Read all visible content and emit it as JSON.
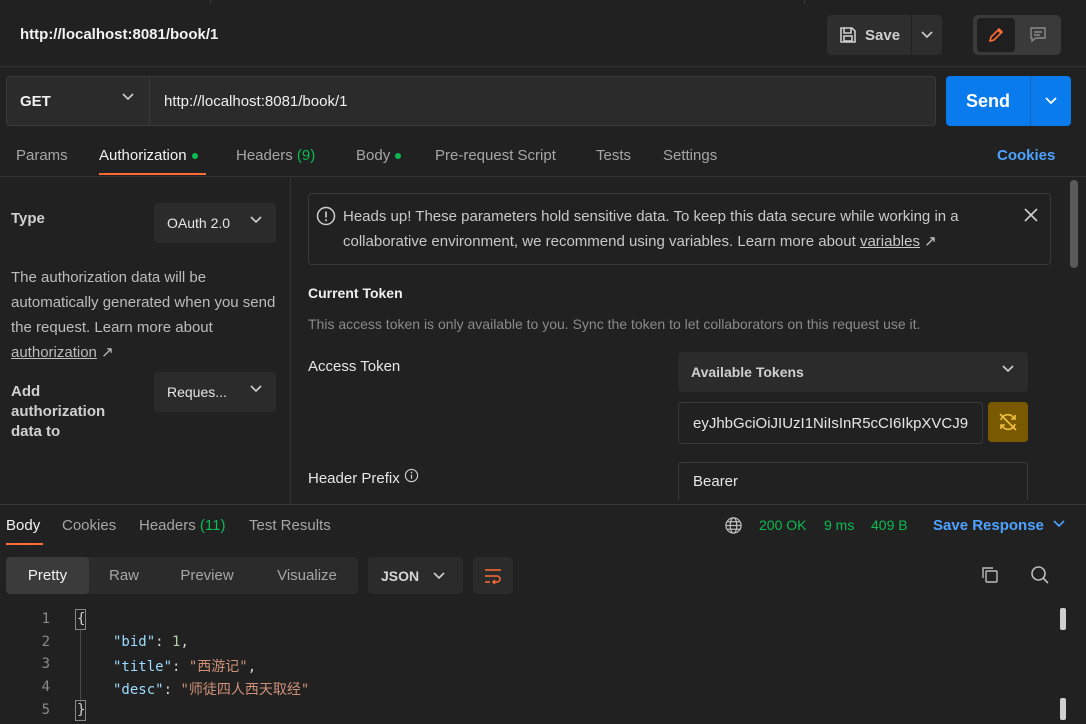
{
  "request": {
    "title": "http://localhost:8081/book/1",
    "save_label": "Save",
    "method": "GET",
    "url": "http://localhost:8081/book/1",
    "send_label": "Send"
  },
  "req_tabs": [
    {
      "label": "Params"
    },
    {
      "label": "Authorization"
    },
    {
      "label": "Headers",
      "count": "(9)"
    },
    {
      "label": "Body"
    },
    {
      "label": "Pre-request Script"
    },
    {
      "label": "Tests"
    },
    {
      "label": "Settings"
    }
  ],
  "cookies_link": "Cookies",
  "auth": {
    "type_label": "Type",
    "type_value": "OAuth 2.0",
    "desc": "The authorization data will be automatically generated when you send the request. Learn more about",
    "desc_link": "authorization",
    "add_label": "Add authorization data to",
    "add_value": "Reques..."
  },
  "alert": {
    "text": "Heads up! These parameters hold sensitive data. To keep this data secure while working in a collaborative environment, we recommend using variables. Learn more about",
    "link": "variables"
  },
  "token": {
    "title": "Current Token",
    "subtitle": "This access token is only available to you. Sync the token to let collaborators on this request use it.",
    "access_label": "Access Token",
    "available_label": "Available Tokens",
    "value": "eyJhbGciOiJIUzI1NiIsInR5cCI6IkpXVCJ9",
    "prefix_label": "Header Prefix",
    "prefix_value": "Bearer"
  },
  "response": {
    "tabs": [
      {
        "label": "Body"
      },
      {
        "label": "Cookies"
      },
      {
        "label": "Headers",
        "count": "(11)"
      },
      {
        "label": "Test Results"
      }
    ],
    "status": "200 OK",
    "time": "9 ms",
    "size": "409 B",
    "save_label": "Save Response",
    "views": [
      "Pretty",
      "Raw",
      "Preview",
      "Visualize"
    ],
    "format": "JSON",
    "lines": [
      "1",
      "2",
      "3",
      "4",
      "5"
    ],
    "code": {
      "open": "{",
      "bid_key": "\"bid\"",
      "bid_val": "1",
      "title_key": "\"title\"",
      "title_val": "\"西游记\"",
      "desc_key": "\"desc\"",
      "desc_val": "\"师徒四人西天取经\"",
      "close": "}"
    }
  },
  "colors": {
    "accent": "#ff6c37",
    "send": "#097bed",
    "success": "#0cbb52",
    "link": "#4da3ff"
  }
}
